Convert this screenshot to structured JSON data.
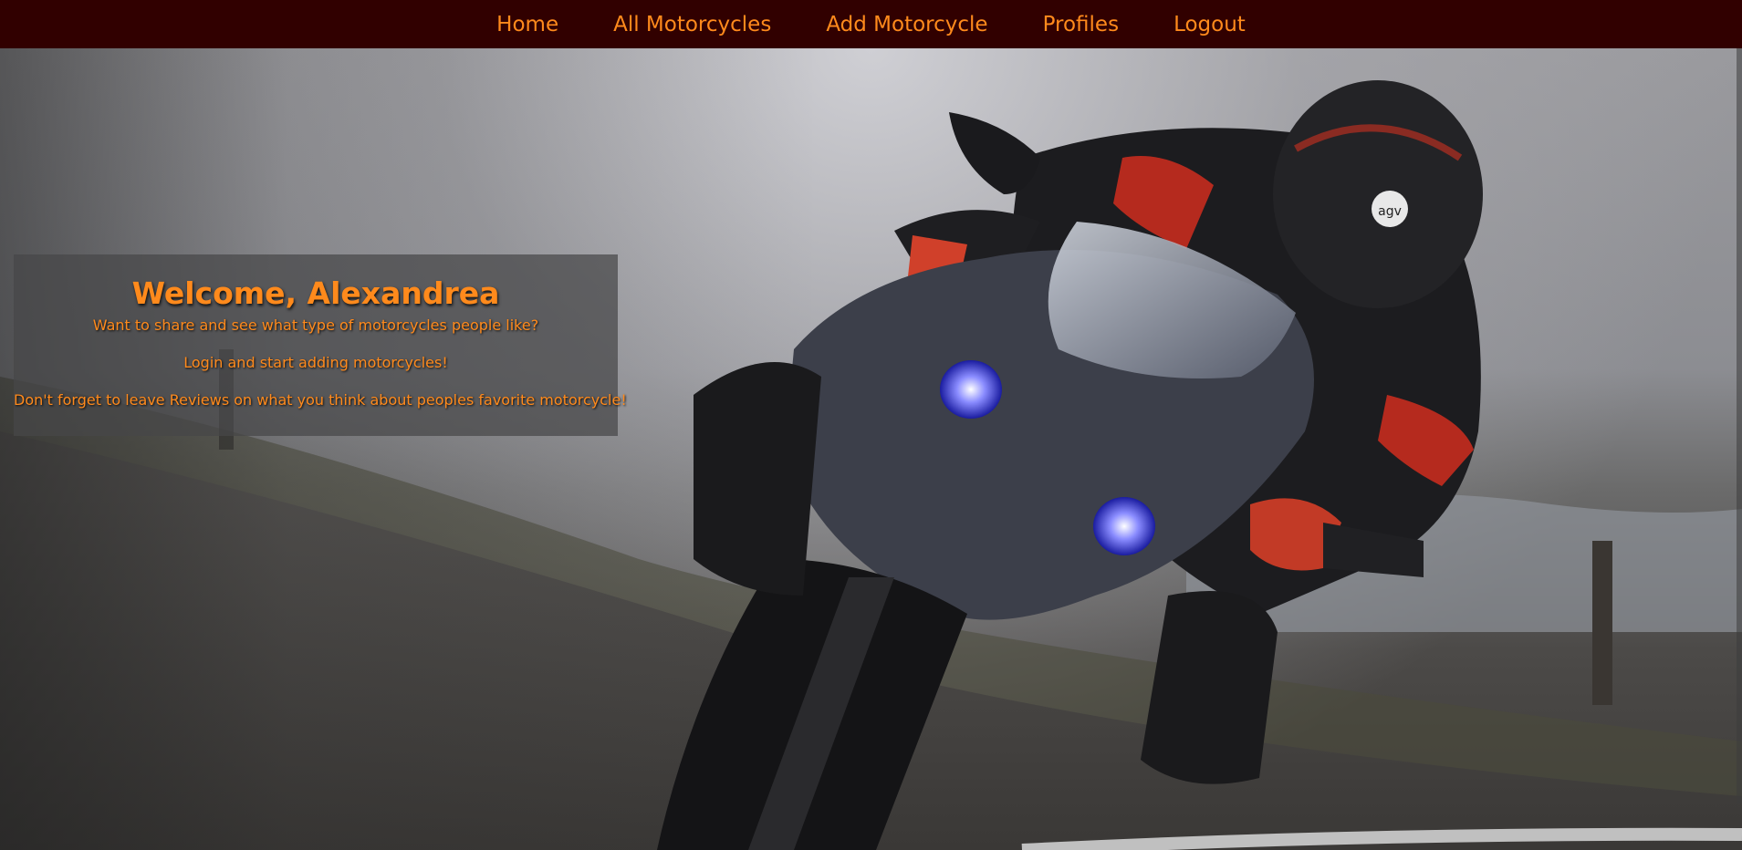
{
  "nav": {
    "items": [
      {
        "label": "Home"
      },
      {
        "label": "All Motorcycles"
      },
      {
        "label": "Add Motorcycle"
      },
      {
        "label": "Profiles"
      },
      {
        "label": "Logout"
      }
    ]
  },
  "welcome": {
    "title": "Welcome, Alexandrea",
    "line1": "Want to share and see what type of motorcycles people like?",
    "line2": "Login and start adding motorcycles!",
    "line3": "Don't forget to leave Reviews on what you think about peoples favorite motorcycle!"
  },
  "hero_image": {
    "helmet_logo": "agv",
    "icon": "motorcycle-rider-photo"
  },
  "colors": {
    "navbar_bg": "#310000",
    "accent_orange": "#ff8a1c",
    "panel_bg": "rgba(70,70,72,0.72)"
  }
}
